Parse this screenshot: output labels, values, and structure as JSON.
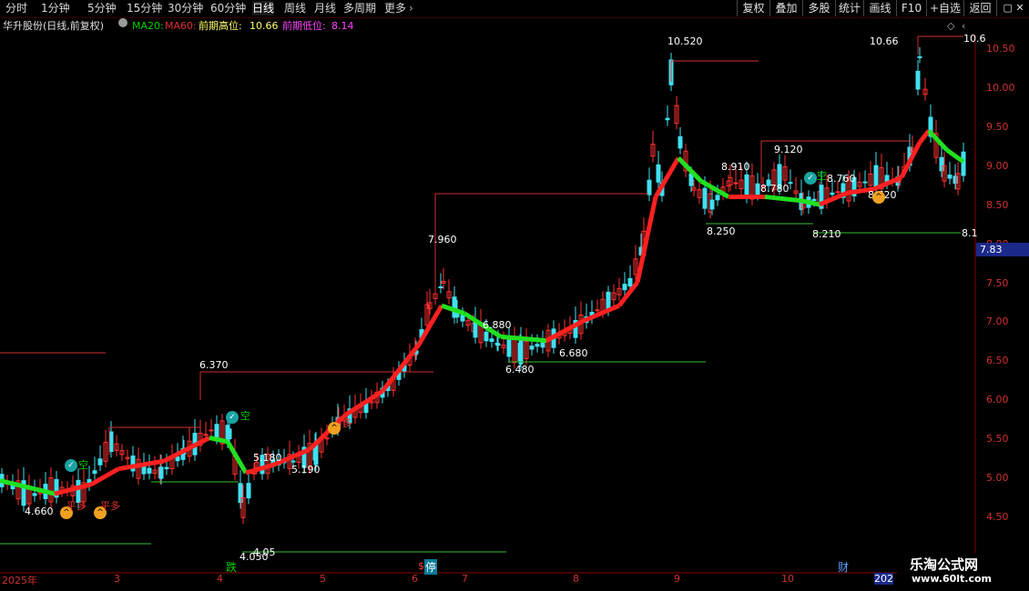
{
  "toolbar": {
    "tabs": [
      "分时",
      "1分钟",
      "5分钟",
      "15分钟",
      "30分钟",
      "60分钟",
      "日线",
      "周线",
      "月线",
      "多周期",
      "更多"
    ],
    "active_tab": "日线",
    "right_buttons": [
      "复权",
      "叠加",
      "多股",
      "统计",
      "画线",
      "F10",
      "+自选",
      "返回"
    ]
  },
  "info": {
    "stock": "华升股份(日线,前复权)",
    "ma20": "MA20:",
    "ma60": "MA60:",
    "high_label": "前期高位:",
    "high_value": "10.66",
    "low_label": "前期低位:",
    "low_value": "8.14",
    "colors": {
      "ma20": "#00d000",
      "ma60": "#e03030",
      "high": "#ffff66",
      "low": "#ff44ff"
    }
  },
  "axis": {
    "ticks": [
      "10.50",
      "10.00",
      "9.50",
      "9.00",
      "8.50",
      "8.00",
      "7.50",
      "7.00",
      "6.50",
      "6.00",
      "5.50",
      "5.00",
      "4.50"
    ],
    "current_price": "7.83"
  },
  "price_labels": {
    "p10520": "10.520",
    "p1066": "10.66",
    "p108": "10.6",
    "p9120": "9.120",
    "p8910": "8.910",
    "p8760": "8.760",
    "p8780": "8.780",
    "p8720": "8.720",
    "p8250": "8.250",
    "p8210": "8.210",
    "p81": "8.1",
    "p7960": "7.960",
    "p6880": "6.880",
    "p6680": "6.680",
    "p6480": "6.480",
    "p6370": "6.370",
    "p5180": "5.180",
    "p5190": "5.190",
    "p4660": "4.660",
    "p4050": "4.050",
    "p405": "4.05"
  },
  "signals": {
    "kong": "空",
    "duo": "多",
    "pingduo1": "平多",
    "pingduo2": "平多",
    "die": "跌",
    "ting": "停",
    "cai": "财"
  },
  "dates": [
    "2025年",
    "3",
    "4",
    "5",
    "6",
    "7",
    "8",
    "9",
    "10",
    "202"
  ],
  "watermark": {
    "title": "乐淘公式网",
    "url": "www.60lt.com"
  }
}
